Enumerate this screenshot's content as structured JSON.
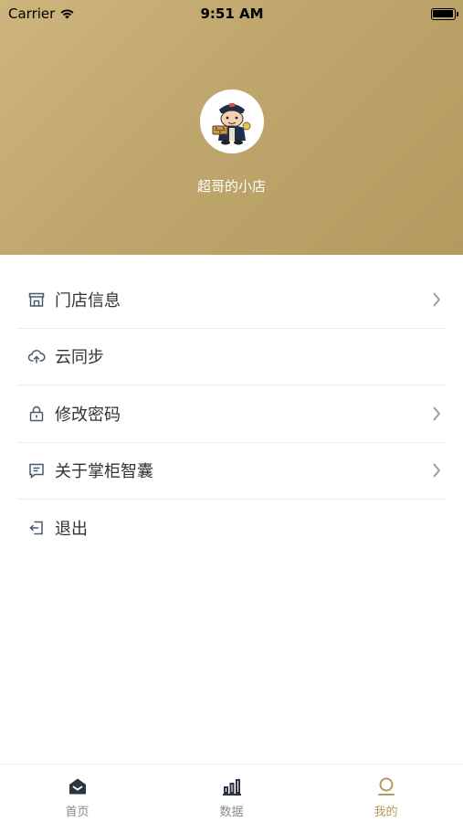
{
  "status_bar": {
    "carrier": "Carrier",
    "time": "9:51 AM"
  },
  "profile": {
    "store_name": "超哥的小店"
  },
  "menu": {
    "items": [
      {
        "label": "门店信息",
        "icon": "store-icon",
        "has_arrow": true
      },
      {
        "label": "云同步",
        "icon": "cloud-upload-icon",
        "has_arrow": false
      },
      {
        "label": "修改密码",
        "icon": "lock-icon",
        "has_arrow": true
      },
      {
        "label": "关于掌柜智囊",
        "icon": "message-icon",
        "has_arrow": true
      },
      {
        "label": "退出",
        "icon": "logout-icon",
        "has_arrow": false
      }
    ]
  },
  "tabbar": {
    "items": [
      {
        "label": "首页",
        "icon": "home-icon",
        "active": false
      },
      {
        "label": "数据",
        "icon": "bar-chart-icon",
        "active": false
      },
      {
        "label": "我的",
        "icon": "profile-icon",
        "active": true
      }
    ]
  },
  "colors": {
    "accent": "#b49a5f",
    "header_start": "#cdb57d",
    "header_end": "#b49a5f",
    "icon": "#4a5a6a"
  }
}
